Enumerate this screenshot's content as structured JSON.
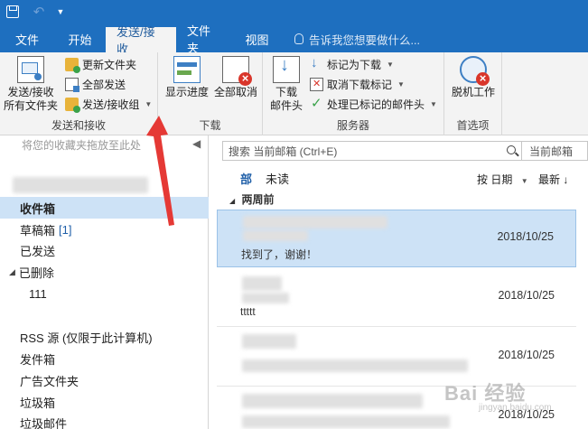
{
  "quick_access": {
    "save_icon": "save-icon",
    "undo_icon": "undo-icon",
    "customize_icon": "chevron-down-icon"
  },
  "tabs": [
    {
      "label": "文件",
      "active": false
    },
    {
      "label": "开始",
      "active": false
    },
    {
      "label": "发送/接收",
      "active": true
    },
    {
      "label": "文件夹",
      "active": false
    },
    {
      "label": "视图",
      "active": false
    }
  ],
  "tell_me": "告诉我您想要做什么...",
  "ribbon": {
    "send_receive_group": {
      "label": "发送和接收",
      "send_all_line1": "发送/接收",
      "send_all_line2": "所有文件夹",
      "update_folder": "更新文件夹",
      "send_all": "全部发送",
      "send_receive_groups": "发送/接收组"
    },
    "download_group": {
      "label": "下载",
      "show_progress": "显示进度",
      "cancel_all": "全部取消"
    },
    "server_group": {
      "label": "服务器",
      "download_headers_line1": "下载",
      "download_headers_line2": "邮件头",
      "mark_to_download": "标记为下载",
      "unmark_download": "取消下载标记",
      "process_marked": "处理已标记的邮件头"
    },
    "preferences_group": {
      "label": "首选项",
      "work_offline": "脱机工作"
    }
  },
  "left_pane": {
    "favorites_hint": "将您的收藏夹拖放至此处",
    "folders": [
      {
        "label": "收件箱",
        "count": "",
        "selected": true
      },
      {
        "label": "草稿箱",
        "count": "[1]",
        "selected": false
      },
      {
        "label": "已发送",
        "count": "",
        "selected": false
      },
      {
        "label": "已删除",
        "count": "",
        "selected": false
      },
      {
        "label": "111",
        "count": "",
        "selected": false
      },
      {
        "label": "RSS 源 (仅限于此计算机)",
        "count": "",
        "selected": false
      },
      {
        "label": "发件箱",
        "count": "",
        "selected": false
      },
      {
        "label": "广告文件夹",
        "count": "",
        "selected": false
      },
      {
        "label": "垃圾箱",
        "count": "",
        "selected": false
      },
      {
        "label": "垃圾邮件",
        "count": "",
        "selected": false
      }
    ]
  },
  "right_pane": {
    "search_placeholder": "搜索 当前邮箱 (Ctrl+E)",
    "search_scope": "当前邮箱",
    "filter_all": "部",
    "filter_unread": "未读",
    "sort_by": "按 日期",
    "order": "最新",
    "group_header": "两周前",
    "messages": [
      {
        "date": "2018/10/25",
        "preview": "找到了，谢谢！",
        "sender_text": "",
        "selected": true
      },
      {
        "date": "2018/10/25",
        "preview": "ttttt",
        "sender_text": "",
        "selected": false
      },
      {
        "date": "2018/10/25",
        "preview": "",
        "sender_text": "",
        "selected": false
      },
      {
        "date": "2018/10/25",
        "preview": "",
        "sender_text": "",
        "selected": false
      }
    ]
  },
  "watermark": {
    "text": "Bai 经验",
    "sub": "jingyan.baidu.com"
  },
  "colors": {
    "accent": "#1e6fbf",
    "selection": "#cde2f6",
    "annotation": "#e53935"
  }
}
